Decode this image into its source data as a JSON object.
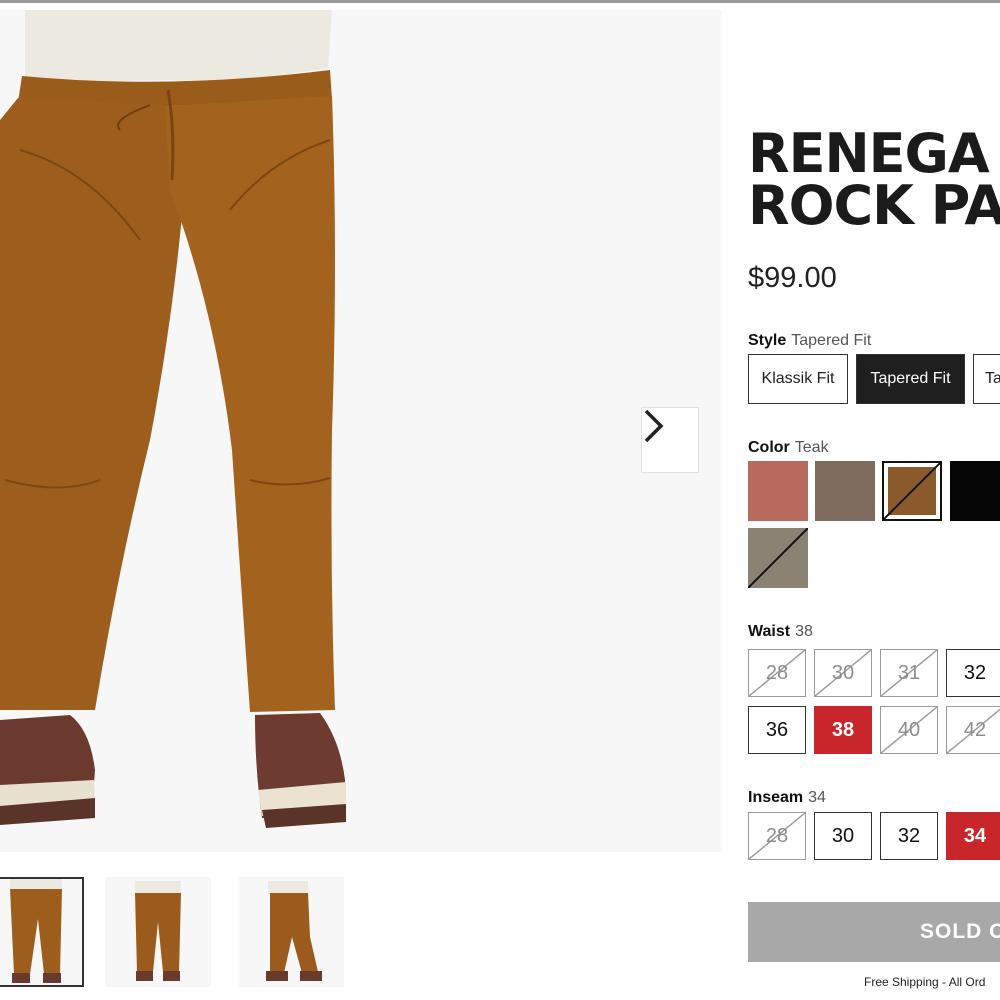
{
  "product": {
    "title_line1": "RENEGA",
    "title_line2": "ROCK PA",
    "price": "$99.00"
  },
  "gallery": {
    "main_image": "khaki-pants-model-photo",
    "next_icon": "chevron-right-icon",
    "thumbnails": [
      "front-view",
      "back-view",
      "side-view"
    ]
  },
  "style": {
    "label": "Style",
    "selected": "Tapered Fit",
    "options": [
      "Klassik Fit",
      "Tapered Fit",
      "Ta"
    ]
  },
  "color": {
    "label": "Color",
    "selected": "Teak",
    "swatches": [
      "#b86b5c",
      "#7f6c5f",
      "#8a5a2a",
      "#050505",
      "#8b8274"
    ]
  },
  "waist": {
    "label": "Waist",
    "selected": "38",
    "row1": [
      "28",
      "30",
      "31",
      "32"
    ],
    "row2": [
      "36",
      "38",
      "40",
      "42"
    ]
  },
  "inseam": {
    "label": "Inseam",
    "selected": "34",
    "options": [
      "28",
      "30",
      "32",
      "34"
    ]
  },
  "cta": {
    "soldout_label": "SOLD O",
    "shipping_text": "Free Shipping - All Ord"
  }
}
